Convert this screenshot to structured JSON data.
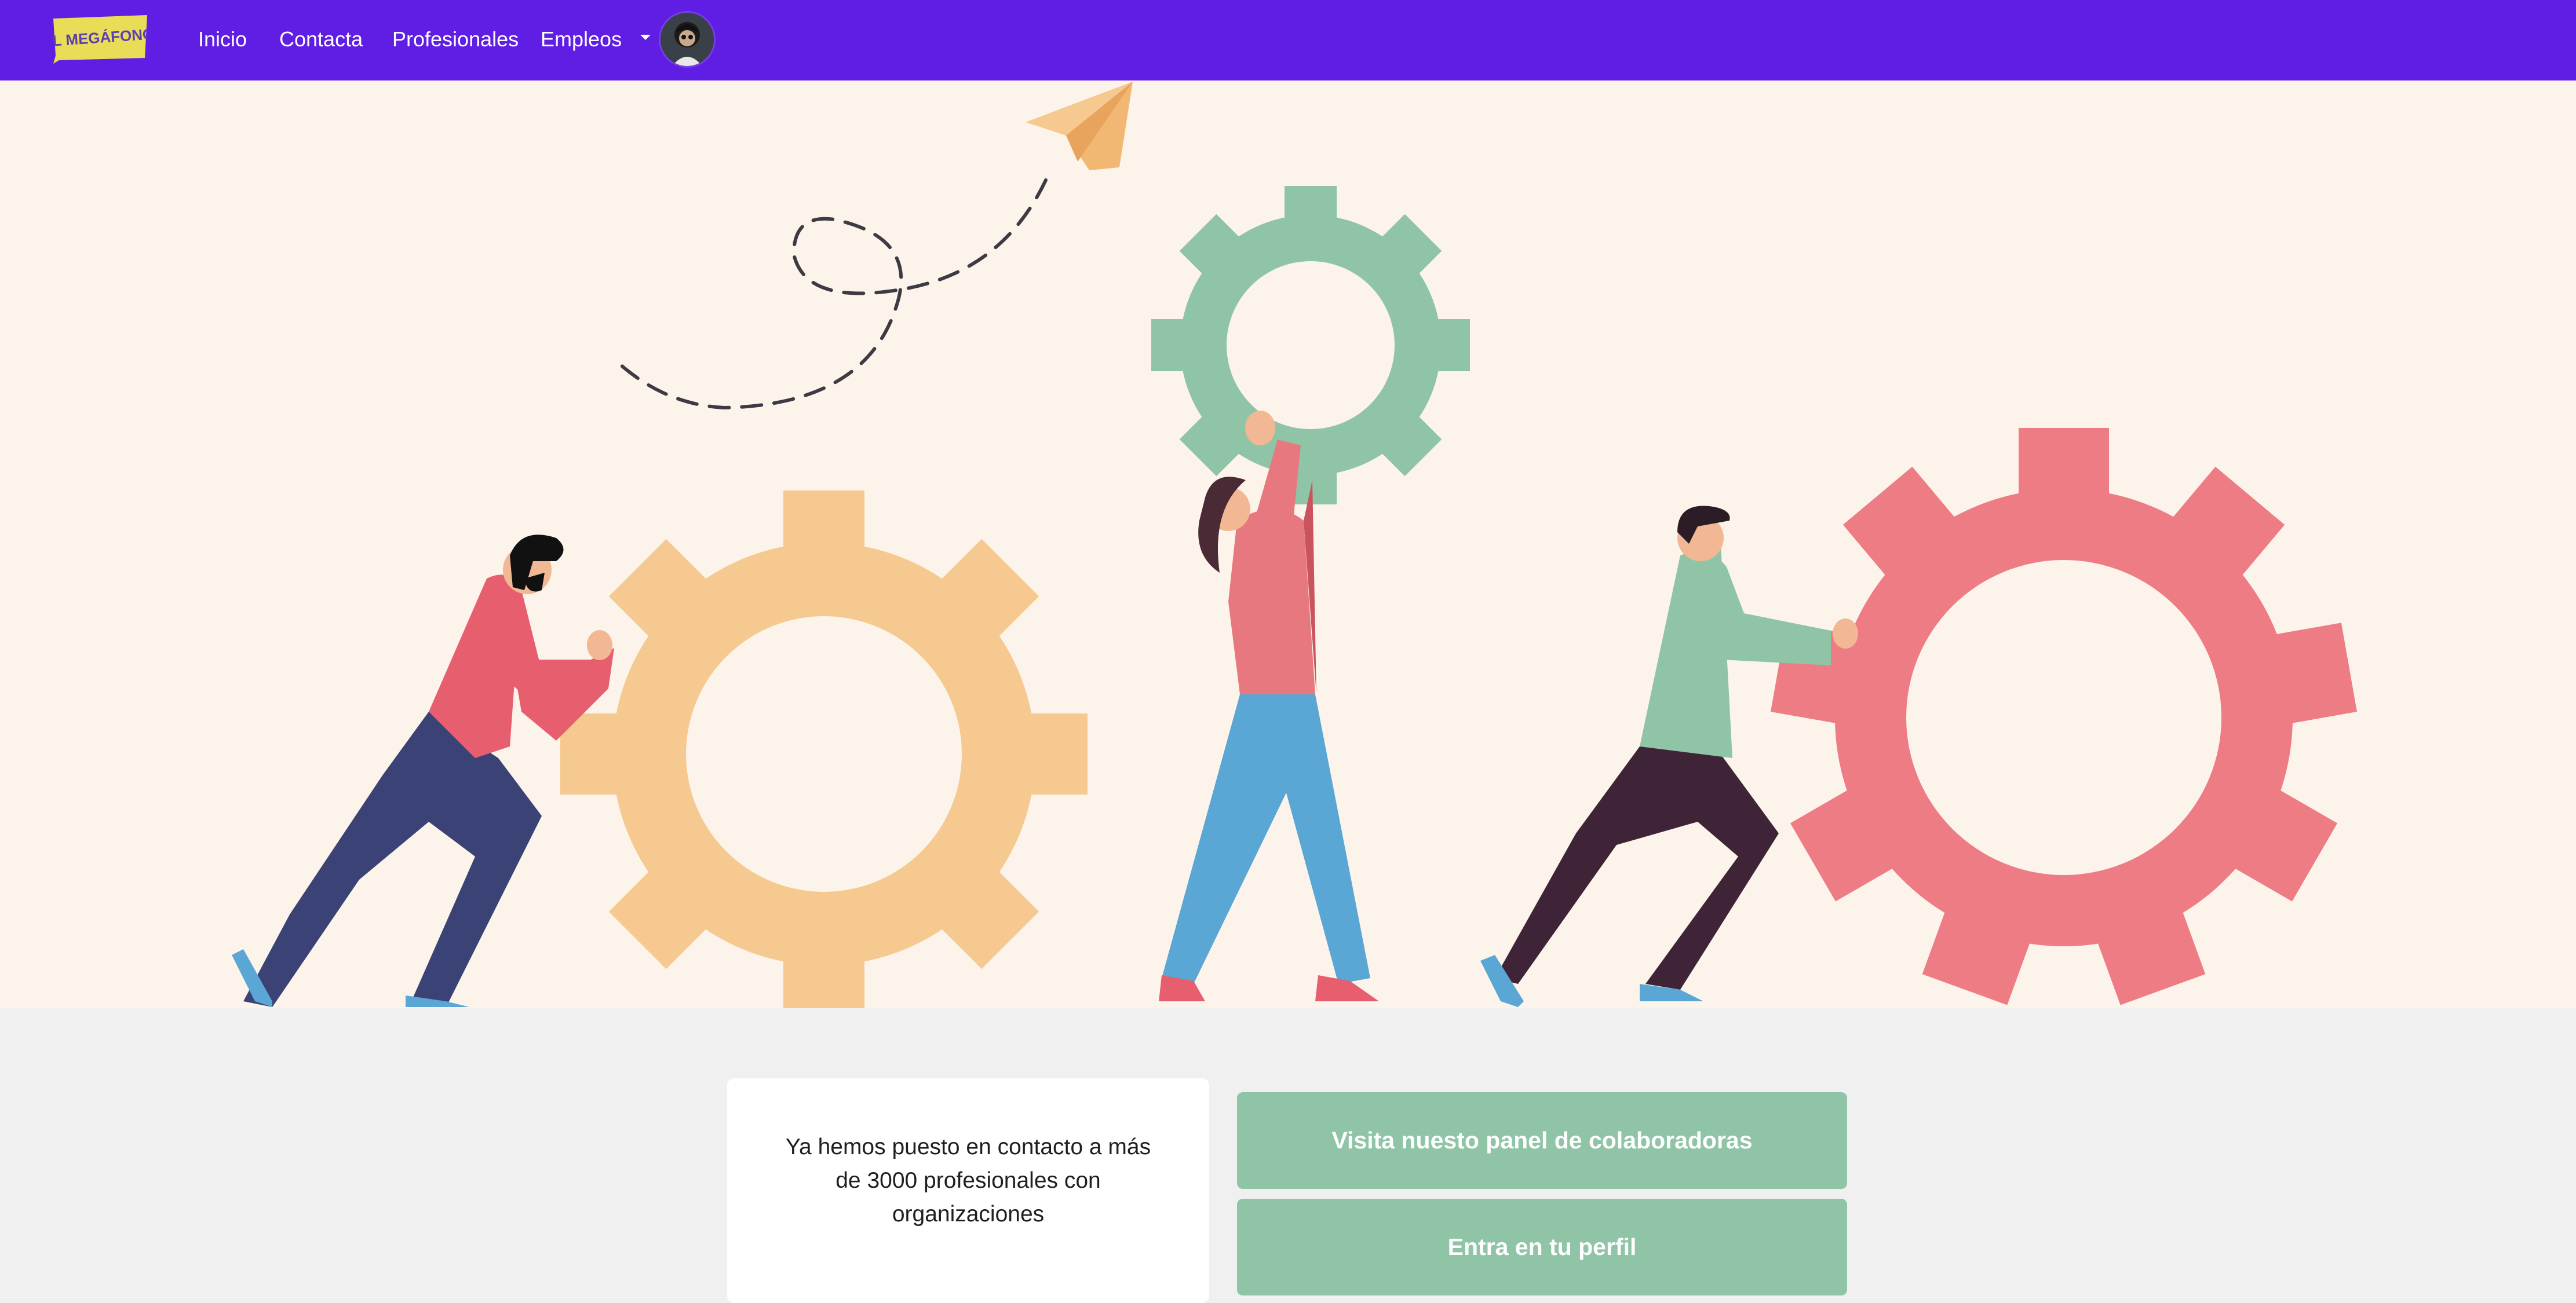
{
  "navbar": {
    "logo_text": "EL MEGÁFONO",
    "links": [
      {
        "label": "Inicio"
      },
      {
        "label": "Contacta"
      },
      {
        "label": "Profesionales"
      },
      {
        "label": "Empleos"
      }
    ],
    "icons": {
      "dropdown": "caret-down-icon",
      "avatar": "user-avatar"
    }
  },
  "colors": {
    "navbar_bg": "#601de3",
    "hero_bg": "#fcf4ea",
    "page_bg": "#f0f0f0",
    "button_bg": "#8fc4a7",
    "logo_yellow": "#e9dd57",
    "gear_orange": "#f5c98f",
    "gear_green": "#90c4a7",
    "gear_pink": "#ee7c84"
  },
  "stats": {
    "text": "Ya hemos puesto en contacto a más de 3000 profesionales con organizaciones"
  },
  "actions": {
    "panel_button": "Visita nuesto panel de colaboradoras",
    "profile_button": "Entra en tu perfil"
  }
}
